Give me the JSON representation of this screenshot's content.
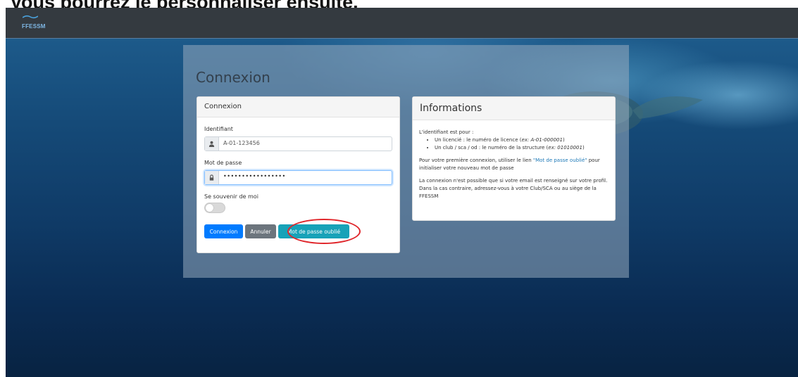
{
  "caption": "Vous pourrez le personnaliser ensuite.",
  "header": {
    "logo_text": "FFESSM"
  },
  "page_title": "Connexion",
  "login": {
    "card_title": "Connexion",
    "identifier_label": "Identifiant",
    "identifier_value": "A-01-123456",
    "password_label": "Mot de passe",
    "password_value": "•••••••••••••••••",
    "remember_label": "Se souvenir de moi",
    "remember_checked": false,
    "login_button": "Connexion",
    "cancel_button": "Annuler",
    "forgot_button": "Mot de passe oublié"
  },
  "info": {
    "title": "Informations",
    "intro": "L'identifiant est pour :",
    "item1_prefix": "Un licencié : le numéro de licence (",
    "item1_example": "ex: A-01-000001",
    "item1_suffix": ")",
    "item2_prefix": "Un club / sca / od : le numéro de la structure (",
    "item2_example": "ex: 01010001",
    "item2_suffix": ")",
    "para2_before": "Pour votre première connexion, utiliser le lien ",
    "para2_link": "\"Mot de passe oublié\"",
    "para2_after": " pour initialiser votre nouveau mot de passe",
    "para3": "La connexion n'est possible que si votre email est renseigné sur votre profil. Dans la cas contraire, adressez-vous à votre Club/SCA ou au siège de la FFESSM"
  },
  "colors": {
    "primary": "#007bff",
    "secondary": "#6c757d",
    "info": "#17a2b8",
    "highlight_circle": "#e0262b",
    "topbar": "#343a40"
  },
  "icons": {
    "identifier_addon": "user-icon",
    "password_addon": "lock-icon",
    "logo": "ffessm-logo"
  }
}
